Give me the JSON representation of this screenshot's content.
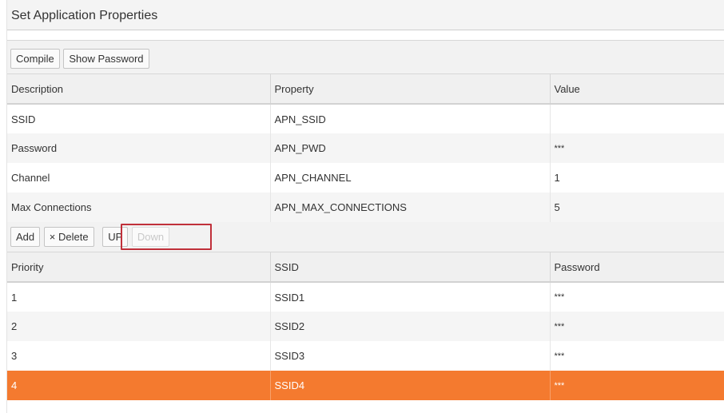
{
  "panel": {
    "title": "Set Application Properties"
  },
  "properties_toolbar": {
    "compile_label": "Compile",
    "show_password_label": "Show Password"
  },
  "properties_table": {
    "headers": [
      "Description",
      "Property",
      "Value"
    ],
    "rows": [
      [
        "SSID",
        "APN_SSID",
        ""
      ],
      [
        "Password",
        "APN_PWD",
        "***"
      ],
      [
        "Channel",
        "APN_CHANNEL",
        "1"
      ],
      [
        "Max Connections",
        "APN_MAX_CONNECTIONS",
        "5"
      ]
    ]
  },
  "ssid_toolbar": {
    "add_label": "Add",
    "delete_label": "× Delete",
    "up_label": "UP",
    "down_label": "Down"
  },
  "ssid_table": {
    "headers": [
      "Priority",
      "SSID",
      "Password"
    ],
    "rows": [
      [
        "1",
        "SSID1",
        "***"
      ],
      [
        "2",
        "SSID2",
        "***"
      ],
      [
        "3",
        "SSID3",
        "***"
      ],
      [
        "4",
        "SSID4",
        "***"
      ]
    ],
    "selected_row": 4
  },
  "colors": {
    "selected_row": "#f47a2f",
    "highlight_box": "#c0303a"
  }
}
